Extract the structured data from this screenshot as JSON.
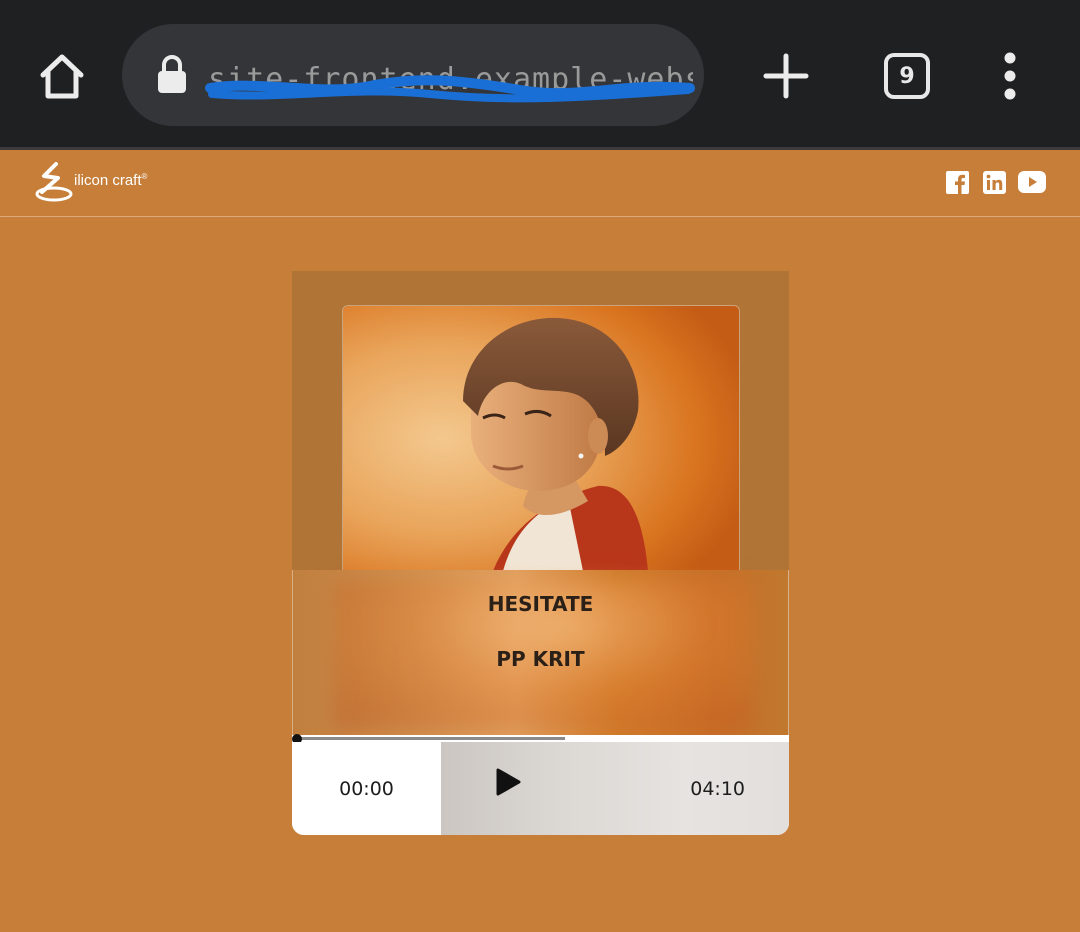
{
  "browser": {
    "url": "site-frontend.example-websites.net",
    "tab_count": "9",
    "icons": {
      "home": "home-icon",
      "lock": "lock-icon",
      "new_tab": "plus-icon",
      "menu": "kebab-menu-icon"
    }
  },
  "site": {
    "brand": "ilicon craft",
    "trademark": "®",
    "social": [
      "facebook-icon",
      "linkedin-icon",
      "youtube-icon"
    ],
    "colors": {
      "background": "#C67E38",
      "card_frame": "#B07436"
    }
  },
  "player": {
    "title": "HESITATE",
    "artist": "PP KRIT",
    "current_time": "00:00",
    "duration": "04:10",
    "progress": 0,
    "buffered": 0.54,
    "play_icon": "play-icon"
  }
}
